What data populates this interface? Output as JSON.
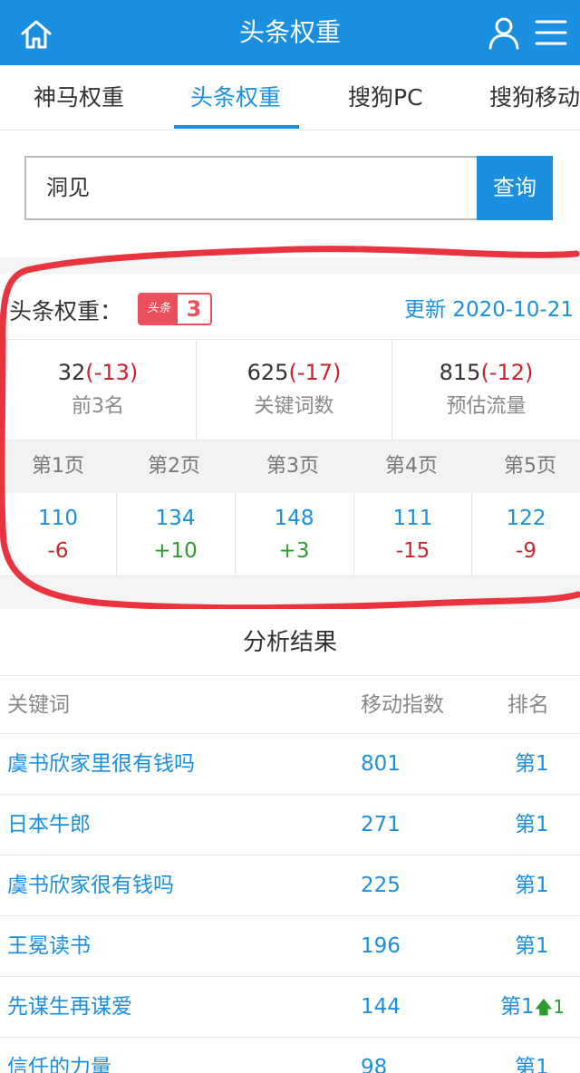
{
  "header": {
    "title": "头条权重"
  },
  "tabs": [
    {
      "label": "神马权重"
    },
    {
      "label": "头条权重"
    },
    {
      "label": "搜狗PC"
    },
    {
      "label": "搜狗移动"
    }
  ],
  "search": {
    "value": "洞见",
    "button": "查询"
  },
  "weight": {
    "label": "头条权重：",
    "badge_logo": "头条",
    "badge_value": "3",
    "update": "更新 2020-10-21"
  },
  "stats": [
    {
      "value": "32",
      "delta": "(-13)",
      "label": "前3名"
    },
    {
      "value": "625",
      "delta": "(-17)",
      "label": "关键词数"
    },
    {
      "value": "815",
      "delta": "(-12)",
      "label": "预估流量"
    }
  ],
  "pages": [
    {
      "label": "第1页",
      "count": "110",
      "change": "-6"
    },
    {
      "label": "第2页",
      "count": "134",
      "change": "+10"
    },
    {
      "label": "第3页",
      "count": "148",
      "change": "+3"
    },
    {
      "label": "第4页",
      "count": "111",
      "change": "-15"
    },
    {
      "label": "第5页",
      "count": "122",
      "change": "-9"
    }
  ],
  "results": {
    "title": "分析结果",
    "columns": {
      "keyword": "关键词",
      "index": "移动指数",
      "rank": "排名"
    },
    "rows": [
      {
        "keyword": "虞书欣家里很有钱吗",
        "index": "801",
        "rank": "第1",
        "rank_change": ""
      },
      {
        "keyword": "日本牛郎",
        "index": "271",
        "rank": "第1",
        "rank_change": ""
      },
      {
        "keyword": "虞书欣家很有钱吗",
        "index": "225",
        "rank": "第1",
        "rank_change": ""
      },
      {
        "keyword": "王冕读书",
        "index": "196",
        "rank": "第1",
        "rank_change": ""
      },
      {
        "keyword": "先谋生再谋爱",
        "index": "144",
        "rank": "第1",
        "rank_change": "1"
      },
      {
        "keyword": "信任的力量",
        "index": "98",
        "rank": "第1",
        "rank_change": ""
      }
    ]
  },
  "colors": {
    "primary": "#1a8fe0",
    "negative": "#c9242b",
    "positive": "#2e9b2e",
    "annotation": "#e8343f"
  }
}
